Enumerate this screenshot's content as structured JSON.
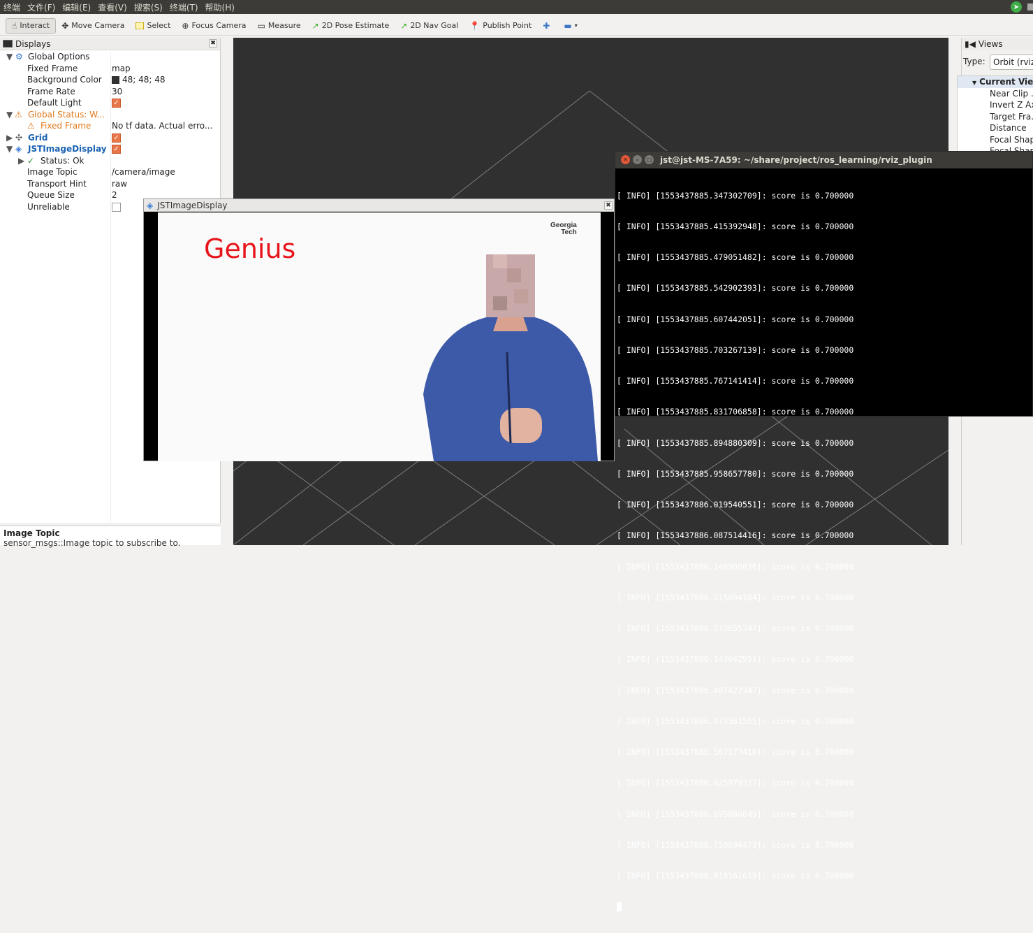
{
  "menubar": {
    "items": [
      "终端",
      "文件(F)",
      "编辑(E)",
      "查看(V)",
      "搜索(S)",
      "终端(T)",
      "帮助(H)"
    ]
  },
  "toolbar": {
    "interact": "Interact",
    "move_camera": "Move Camera",
    "select": "Select",
    "focus_camera": "Focus Camera",
    "measure": "Measure",
    "pose_estimate": "2D Pose Estimate",
    "nav_goal": "2D Nav Goal",
    "publish_point": "Publish Point"
  },
  "displays": {
    "title": "Displays",
    "global_options": "Global Options",
    "fixed_frame_label": "Fixed Frame",
    "fixed_frame_value": "map",
    "background_color_label": "Background Color",
    "background_color_value": "48; 48; 48",
    "background_color_hex": "#303030",
    "frame_rate_label": "Frame Rate",
    "frame_rate_value": "30",
    "default_light_label": "Default Light",
    "global_status_label": "Global Status: W...",
    "status_fixed_frame_label": "Fixed Frame",
    "status_fixed_frame_value": "No tf data.  Actual erro...",
    "grid_label": "Grid",
    "jst_label": "JSTImageDisplay",
    "status_ok_label": "Status: Ok",
    "image_topic_label": "Image Topic",
    "image_topic_value": "/camera/image",
    "transport_hint_label": "Transport Hint",
    "transport_hint_value": "raw",
    "queue_size_label": "Queue Size",
    "queue_size_value": "2",
    "unreliable_label": "Unreliable"
  },
  "help": {
    "title": "Image Topic",
    "description": "sensor_msgs::Image topic to subscribe to."
  },
  "views": {
    "title": "Views",
    "type_label": "Type:",
    "type_value": "Orbit (rviz)",
    "current_view": "Current View",
    "items": [
      "Near Clip ...",
      "Invert Z Ax...",
      "Target Fra...",
      "Distance",
      "Focal Shap...",
      "Focal Shap..."
    ]
  },
  "image_window": {
    "title": "JSTImageDisplay",
    "overlay_text": "Genius",
    "logo_line1": "Georgia",
    "logo_line2": "Tech"
  },
  "terminal": {
    "title": "jst@jst-MS-7A59: ~/share/project/ros_learning/rviz_plugin",
    "lines": [
      "[ INFO] [1553437885.347302709]: score is 0.700000",
      "[ INFO] [1553437885.415392948]: score is 0.700000",
      "[ INFO] [1553437885.479051482]: score is 0.700000",
      "[ INFO] [1553437885.542902393]: score is 0.700000",
      "[ INFO] [1553437885.607442051]: score is 0.700000",
      "[ INFO] [1553437885.703267139]: score is 0.700000",
      "[ INFO] [1553437885.767141414]: score is 0.700000",
      "[ INFO] [1553437885.831706858]: score is 0.700000",
      "[ INFO] [1553437885.894880309]: score is 0.700000",
      "[ INFO] [1553437885.958657780]: score is 0.700000",
      "[ INFO] [1553437886.019540551]: score is 0.700000",
      "[ INFO] [1553437886.087514416]: score is 0.700000",
      "[ INFO] [1553437886.148909826]: score is 0.700000",
      "[ INFO] [1553437886.215094184]: score is 0.700000",
      "[ INFO] [1553437886.273655347]: score is 0.700000",
      "[ INFO] [1553437886.343042951]: score is 0.700000",
      "[ INFO] [1553437886.407422347]: score is 0.700000",
      "[ INFO] [1553437886.473361555]: score is 0.700000",
      "[ INFO] [1553437886.567577410]: score is 0.700000",
      "[ INFO] [1553437886.625979327]: score is 0.700000",
      "[ INFO] [1553437886.695086849]: score is 0.700000",
      "[ INFO] [1553437886.759694473]: score is 0.700000",
      "[ INFO] [1553437886.818161619]: score is 0.700000"
    ]
  }
}
